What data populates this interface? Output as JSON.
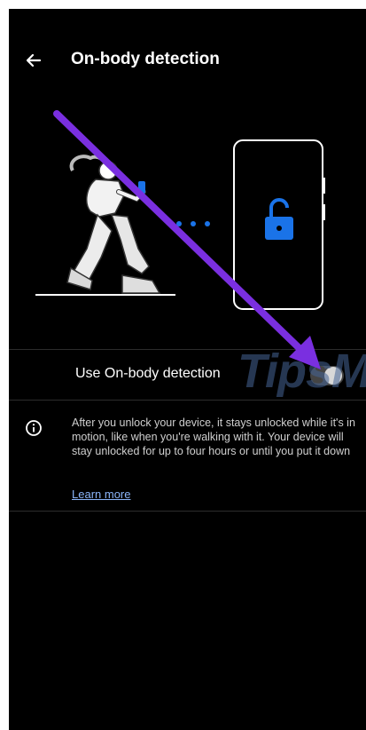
{
  "header": {
    "back_icon": "arrow-left-icon",
    "title": "On-body detection"
  },
  "illustration": {
    "person_icon": "walking-person-icon",
    "phone_icon": "phone-outline-icon",
    "lock_icon": "unlocked-padlock-icon",
    "lock_color": "#1a73e8"
  },
  "setting": {
    "label": "Use On-body detection",
    "toggle_state": "off"
  },
  "info": {
    "icon": "info-icon",
    "description": "After you unlock your device, it stays unlocked while it's in motion, like when you're walking with it. Your device will stay unlocked for up to four hours or until you put it down",
    "learn_more": "Learn more"
  },
  "overlay": {
    "watermark_text": "TipsM",
    "annotation_arrow_color": "#7a2fe0"
  }
}
